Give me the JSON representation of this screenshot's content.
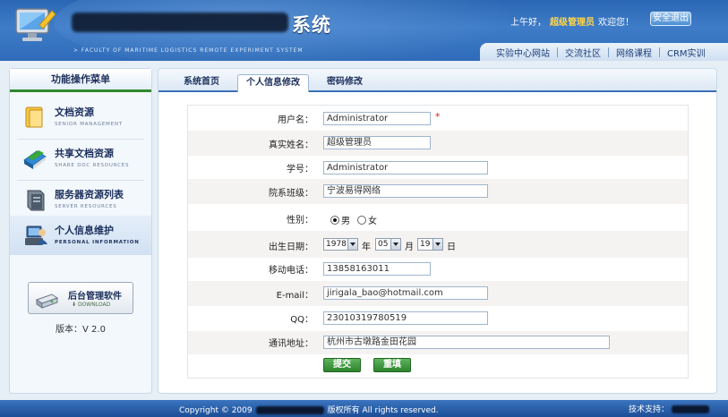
{
  "header": {
    "title_suffix": "系统",
    "subtitle": "> FACULTY OF MARITIME LOGISTICS REMOTE EXPERIMENT SYSTEM",
    "greeting_prefix": "上午好，",
    "user_name": "超级管理员",
    "greeting_suffix": "欢迎您！",
    "logout_label": "安全退出"
  },
  "top_nav": {
    "links": [
      "实验中心网站",
      "交流社区",
      "网络课程",
      "CRM实训"
    ]
  },
  "sidebar": {
    "heading": "功能操作菜单",
    "items": [
      {
        "title": "文档资源",
        "subtitle": "SENIOR MANAGEMENT",
        "icon": "folder-icon"
      },
      {
        "title": "共享文档资源",
        "subtitle": "SHARE DOC RESOURCES",
        "icon": "books-icon"
      },
      {
        "title": "服务器资源列表",
        "subtitle": "SERVER RESOURCES",
        "icon": "server-icon"
      },
      {
        "title": "个人信息维护",
        "subtitle": "PERSONAL INFORMATION",
        "icon": "computer-user-icon"
      }
    ],
    "admin_software": {
      "label": "后台管理软件",
      "download": "DOWNLOAD"
    },
    "version": "版本：V 2.0"
  },
  "tabs": [
    "系统首页",
    "个人信息修改",
    "密码修改"
  ],
  "active_tab_index": 1,
  "form": {
    "username": {
      "label": "用户名：",
      "value": "Administrator",
      "required_mark": "*"
    },
    "real_name": {
      "label": "真实姓名：",
      "value": "超级管理员"
    },
    "student_id": {
      "label": "学号：",
      "value": "Administrator"
    },
    "department_class": {
      "label": "院系班级：",
      "value": "宁波易得网络"
    },
    "gender": {
      "label": "性别：",
      "options": [
        "男",
        "女"
      ],
      "selected": "男"
    },
    "birth_date": {
      "label": "出生日期：",
      "year": "1978",
      "year_unit": "年",
      "month": "05",
      "month_unit": "月",
      "day": "19",
      "day_unit": "日"
    },
    "mobile": {
      "label": "移动电话：",
      "value": "13858163011"
    },
    "email": {
      "label": "E-mail：",
      "value": "jirigala_bao@hotmail.com"
    },
    "qq": {
      "label": "QQ：",
      "value": "23010319780519"
    },
    "address": {
      "label": "通讯地址：",
      "value": "杭州市古墩路金田花园"
    },
    "submit_label": "提交",
    "reset_label": "重填"
  },
  "footer": {
    "copyright_prefix": "Copyright © 2009",
    "copyright_suffix": "版权所有  All rights reserved.",
    "tech_support": "技术支持："
  },
  "colors": {
    "header_blue": "#2f6bb8",
    "accent_green": "#2c842c",
    "user_name_yellow": "#ffd64a"
  }
}
